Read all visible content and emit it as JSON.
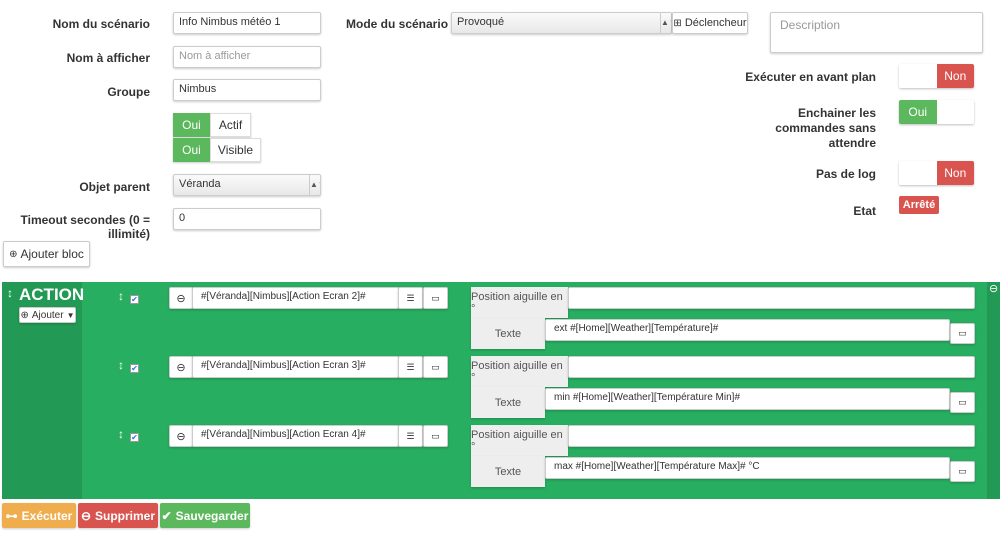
{
  "form": {
    "name_label": "Nom du scénario",
    "name_value": "Info Nimbus météo 1",
    "display_label": "Nom à afficher",
    "display_placeholder": "Nom à afficher",
    "group_label": "Groupe",
    "group_value": "Nimbus",
    "active_on": "Oui",
    "active_label": "Actif",
    "visible_on": "Oui",
    "visible_label": "Visible",
    "parent_label": "Objet parent",
    "parent_value": "Véranda",
    "timeout_label": "Timeout secondes (0 = illimité)",
    "timeout_value": "0",
    "mode_label": "Mode du scénario",
    "mode_value": "Provoqué",
    "trigger_button": "Déclencheur",
    "description_placeholder": "Description",
    "foreground_label": "Exécuter en avant plan",
    "foreground_value": "Non",
    "chain_label_1": "Enchainer les",
    "chain_label_2": "commandes sans",
    "chain_label_3": "attendre",
    "chain_value": "Oui",
    "nolog_label": "Pas de log",
    "nolog_value": "Non",
    "state_label": "Etat",
    "state_value": "Arrêté",
    "add_block": "Ajouter bloc"
  },
  "block": {
    "title": "ACTION",
    "add_button": "Ajouter",
    "rows": [
      {
        "command": "#[Véranda][Nimbus][Action Ecran 2]#",
        "position_label": "Position aiguille en °",
        "position_value": "",
        "text_label": "Texte",
        "text_value": "ext #[Home][Weather][Température]#",
        "enabled": true
      },
      {
        "command": "#[Véranda][Nimbus][Action Ecran 3]#",
        "position_label": "Position aiguille en °",
        "position_value": "",
        "text_label": "Texte",
        "text_value": "min #[Home][Weather][Température Min]#",
        "enabled": true
      },
      {
        "command": "#[Véranda][Nimbus][Action Ecran 4]#",
        "position_label": "Position aiguille en °",
        "position_value": "",
        "text_label": "Texte",
        "text_value": "max #[Home][Weather][Température Max]# °C",
        "enabled": true
      }
    ]
  },
  "footer": {
    "execute": "Exécuter",
    "delete": "Supprimer",
    "save": "Sauvegarder"
  },
  "colors": {
    "block_green": "#27ae60",
    "block_dark": "#229954",
    "red": "#d9534f",
    "green": "#5cb85c",
    "orange": "#f0ad4e"
  }
}
